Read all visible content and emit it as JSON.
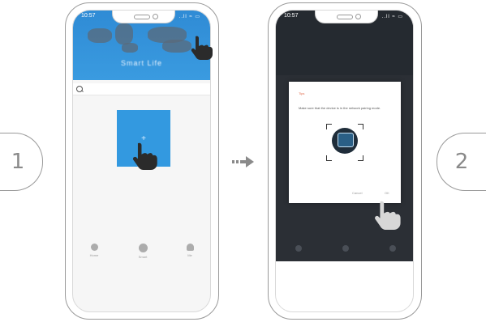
{
  "steps": {
    "step1": "1",
    "step2": "2"
  },
  "phone1": {
    "status_time": "10:57",
    "status_icons": "..ll ≈ ▭",
    "header_title": "Smart Life",
    "add_tile_label": "+",
    "nav": [
      {
        "label": "Home",
        "icon": "home-icon"
      },
      {
        "label": "Smart",
        "icon": "smart-icon"
      },
      {
        "label": "Me",
        "icon": "profile-icon"
      }
    ]
  },
  "phone2": {
    "status_time": "10:57",
    "status_icons": "..ll ≈ ▭",
    "dialog": {
      "title": "Tips",
      "body": "Make sure that the device is in the network pairing mode.",
      "cancel": "Cancel",
      "ok": "OK",
      "device_icon": "device-icon"
    }
  },
  "colors": {
    "accent_blue": "#3399e0",
    "header_blue": "#2f8bd5",
    "dark_overlay": "#2b2f35"
  }
}
